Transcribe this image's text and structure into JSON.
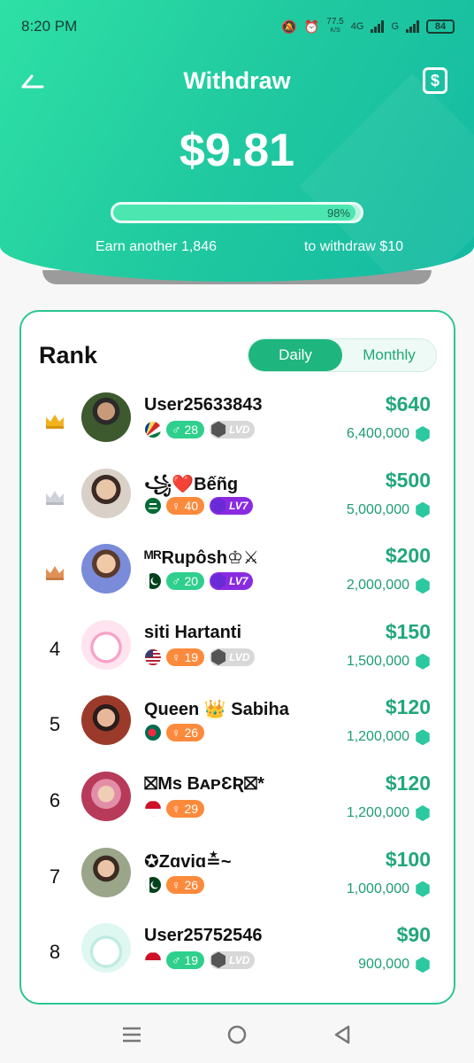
{
  "status_bar": {
    "time": "8:20 PM",
    "net_speed": "77.5",
    "net_unit": "K/S",
    "network_4g": "4G",
    "network_g": "G",
    "battery": "84"
  },
  "header": {
    "title": "Withdraw",
    "balance": "$9.81",
    "progress_label": "98%",
    "progress_value": 0.98,
    "earn_text": "Earn another 1,846",
    "withdraw_text": "to withdraw  $10"
  },
  "rank": {
    "title": "Rank",
    "tabs": [
      {
        "label": "Daily",
        "active": true
      },
      {
        "label": "Monthly",
        "active": false
      }
    ],
    "rows": [
      {
        "position": "",
        "crown": "gold",
        "name": "User25633843",
        "flag": "seychelles",
        "gender": "male",
        "gender_icon": "♂",
        "age": "28",
        "level": "LVD",
        "level_style": "gray",
        "amount": "$640",
        "coins": "6,400,000"
      },
      {
        "position": "",
        "crown": "silver",
        "name": "꧁❤️Bếñg",
        "flag": "saudi",
        "gender": "female",
        "gender_icon": "♀",
        "age": "40",
        "level": "LV7",
        "level_style": "purple",
        "amount": "$500",
        "coins": "5,000,000"
      },
      {
        "position": "",
        "crown": "bronze",
        "name": "ᴹᴿRupôsh♔⚔",
        "flag": "pakistan",
        "gender": "male",
        "gender_icon": "♂",
        "age": "20",
        "level": "LV7",
        "level_style": "purple",
        "amount": "$200",
        "coins": "2,000,000"
      },
      {
        "position": "4",
        "crown": "",
        "name": "siti Hartanti",
        "flag": "usa",
        "gender": "female",
        "gender_icon": "♀",
        "age": "19",
        "level": "LVD",
        "level_style": "gray",
        "amount": "$150",
        "coins": "1,500,000"
      },
      {
        "position": "5",
        "crown": "",
        "name": "Queen 👑 Sabiha",
        "flag": "bangladesh",
        "gender": "female",
        "gender_icon": "♀",
        "age": "26",
        "level": "",
        "level_style": "",
        "amount": "$120",
        "coins": "1,200,000"
      },
      {
        "position": "6",
        "crown": "",
        "name": "⛝Ms BᴀᴘƐƦ⛝*",
        "flag": "indonesia",
        "gender": "female",
        "gender_icon": "♀",
        "age": "29",
        "level": "",
        "level_style": "",
        "amount": "$120",
        "coins": "1,200,000"
      },
      {
        "position": "7",
        "crown": "",
        "name": "✪Zɑviɑ≛~",
        "flag": "pakistan",
        "gender": "female",
        "gender_icon": "♀",
        "age": "26",
        "level": "",
        "level_style": "",
        "amount": "$100",
        "coins": "1,000,000"
      },
      {
        "position": "8",
        "crown": "",
        "name": "User25752546",
        "flag": "indonesia",
        "gender": "male",
        "gender_icon": "♂",
        "age": "19",
        "level": "LVD",
        "level_style": "gray",
        "amount": "$90",
        "coins": "900,000"
      }
    ]
  },
  "colors": {
    "brand": "#20c9a0",
    "accent": "#1fb57f",
    "amount": "#22a77a",
    "female_badge": "#fb8a3c",
    "male_badge": "#2fcf8d",
    "level_purple": "#8a2be2"
  }
}
